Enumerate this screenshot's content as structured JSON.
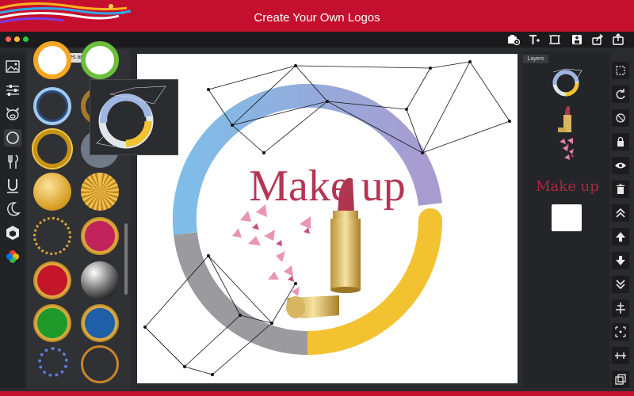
{
  "banner": {
    "title": "Create Your Own Logos"
  },
  "window": {
    "toolbar": {
      "icons": [
        "camera-settings-icon",
        "add-text-icon",
        "crop-frame-icon",
        "save-icon",
        "share-icon",
        "export-icon"
      ]
    },
    "left_tools": [
      "image-icon",
      "sliders-icon",
      "pig-icon",
      "circle-icon",
      "cutlery-icon",
      "u-shape-icon",
      "moon-icon",
      "cube-icon",
      "color-wheel-icon"
    ],
    "shapes_panel": {
      "category_label": "pheres and Circle"
    },
    "canvas": {
      "main_text": "Make up",
      "colors": {
        "ring_blue": "#7fbde8",
        "ring_purple": "#a89bd0",
        "ring_yellow": "#f2c230",
        "ring_gray": "#9b9b9f",
        "text": "#b53552"
      }
    },
    "layers_panel": {
      "tab_label": "Layers",
      "text_layer": "Make up"
    },
    "right_tools": [
      "select-icon",
      "rotate-icon",
      "rotate-ccw-icon",
      "lock-icon",
      "eye-icon",
      "trash-icon",
      "move-top-icon",
      "move-up-icon",
      "move-down-icon",
      "move-bottom-icon",
      "align-icon",
      "center-icon",
      "distribute-icon",
      "duplicate-icon"
    ]
  }
}
